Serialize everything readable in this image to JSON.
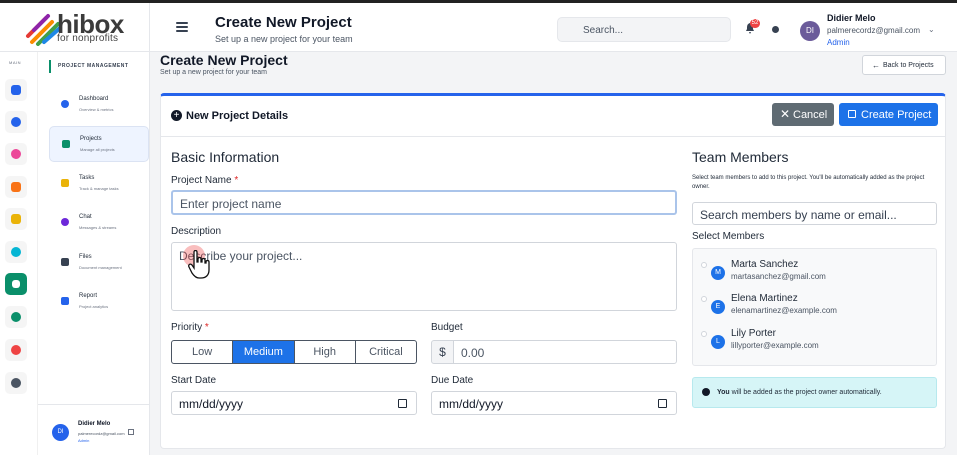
{
  "brand": {
    "name": "hibox",
    "tagline": "for nonprofits"
  },
  "header": {
    "title": "Create New Project",
    "subtitle": "Set up a new project for your team",
    "search_placeholder": "Search...",
    "notification_count": "52",
    "user": {
      "initials": "DI",
      "name": "Didier Melo",
      "email": "palmerecordz@gmail.com",
      "role": "Admin"
    }
  },
  "rail": {
    "label": "MAIN",
    "icons": [
      "home-icon",
      "sitemap-icon",
      "pill-icon",
      "book-icon",
      "graduation-icon",
      "circle-icon",
      "projects-icon",
      "users-icon",
      "chart-pie-icon",
      "gear-icon"
    ]
  },
  "sidebar": {
    "heading": "PROJECT MANAGEMENT",
    "items": [
      {
        "title": "Dashboard",
        "desc": "Overview & metrics",
        "color": "#2563eb"
      },
      {
        "title": "Projects",
        "desc": "Manage all projects",
        "color": "#0a8f6a"
      },
      {
        "title": "Tasks",
        "desc": "Track & manage tasks",
        "color": "#eab308"
      },
      {
        "title": "Chat",
        "desc": "Messages & streams",
        "color": "#6d28d9"
      },
      {
        "title": "Files",
        "desc": "Document management",
        "color": "#374151"
      },
      {
        "title": "Report",
        "desc": "Project analytics",
        "color": "#2563eb"
      }
    ],
    "user": {
      "initials": "DI",
      "name": "Didier Melo",
      "email": "palmerecordz@gmail.com",
      "role": "Admin"
    }
  },
  "page": {
    "title": "Create New Project",
    "subtitle": "Set up a new project for your team",
    "back_label": "Back to Projects"
  },
  "form": {
    "card_title": "New Project Details",
    "cancel_label": "Cancel",
    "create_label": "Create Project",
    "basic_title": "Basic Information",
    "name_label": "Project Name",
    "name_placeholder": "Enter project name",
    "desc_label": "Description",
    "desc_placeholder": "Describe your project...",
    "priority_label": "Priority",
    "priorities": [
      "Low",
      "Medium",
      "High",
      "Critical"
    ],
    "priority_selected": "Medium",
    "budget_label": "Budget",
    "currency": "$",
    "budget_placeholder": "0.00",
    "start_label": "Start Date",
    "start_value": "mm/dd/yyyy",
    "due_label": "Due Date",
    "due_value": "mm/dd/yyyy",
    "required_mark": "*"
  },
  "team": {
    "title": "Team Members",
    "desc": "Select team members to add to this project. You'll be automatically added as the project owner.",
    "search_placeholder": "Search members by name or email...",
    "select_label": "Select Members",
    "members": [
      {
        "initial": "M",
        "name": "Marta Sanchez",
        "email": "martasanchez@gmail.com"
      },
      {
        "initial": "E",
        "name": "Elena Martinez",
        "email": "elenamartinez@example.com"
      },
      {
        "initial": "L",
        "name": "Lily Porter",
        "email": "lillyporter@example.com"
      }
    ],
    "info_bold": "You",
    "info_rest": " will be added as the project owner automatically."
  }
}
